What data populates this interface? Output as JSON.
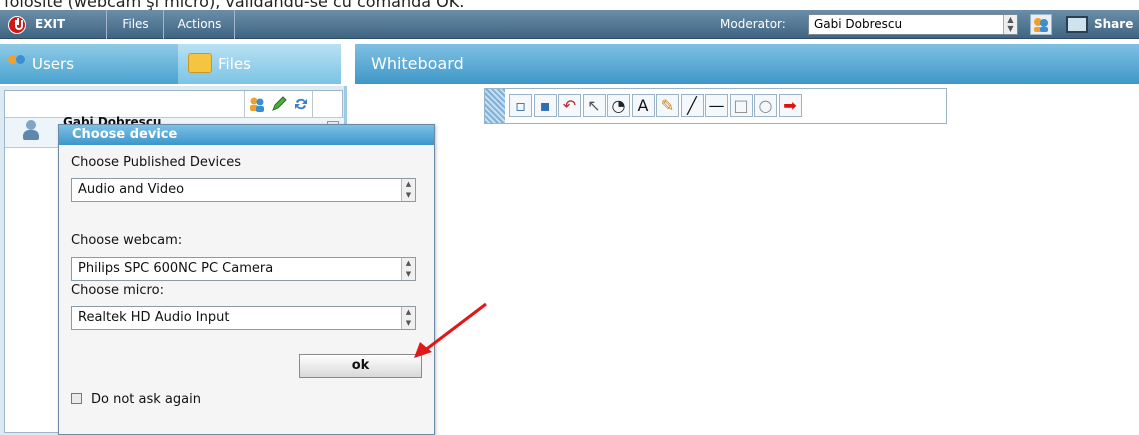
{
  "caption": "folosite (webcam şi micro), validându-se cu comanda OK.",
  "topbar": {
    "exit_label": "EXIT",
    "menu_files": "Files",
    "menu_actions": "Actions",
    "moderator_label": "Moderator:",
    "moderator_value": "Gabi Dobrescu",
    "share_label": "Share"
  },
  "tabs": {
    "users": "Users",
    "files": "Files",
    "whiteboard": "Whiteboard"
  },
  "user_list": {
    "users": [
      "Gabi Dobrescu"
    ]
  },
  "dialog": {
    "title": "Choose device",
    "published_label": "Choose Published Devices",
    "published_value": "Audio and Video",
    "webcam_label": "Choose webcam:",
    "webcam_value": "Philips SPC 600NC PC Camera",
    "micro_label": "Choose micro:",
    "micro_value": "Realtek HD Audio Input",
    "ok_label": "ok",
    "dont_ask_label": "Do not ask again"
  },
  "whiteboard_tools": [
    {
      "icon": "new-page-icon",
      "glyph": "▫",
      "color": "#2f6fb0"
    },
    {
      "icon": "save-icon",
      "glyph": "▪",
      "color": "#2f6fb0"
    },
    {
      "icon": "undo-icon",
      "glyph": "↶",
      "color": "#b03030"
    },
    {
      "icon": "pointer-icon",
      "glyph": "↖",
      "color": "#555555"
    },
    {
      "icon": "ellipse-select-icon",
      "glyph": "◔",
      "color": "#222222"
    },
    {
      "icon": "text-icon",
      "glyph": "A",
      "color": "#111111"
    },
    {
      "icon": "pencil-icon",
      "glyph": "✎",
      "color": "#c8842a"
    },
    {
      "icon": "line-icon",
      "glyph": "╱",
      "color": "#111111"
    },
    {
      "icon": "horizontal-line-icon",
      "glyph": "—",
      "color": "#111111"
    },
    {
      "icon": "rectangle-icon",
      "glyph": "□",
      "color": "#888888"
    },
    {
      "icon": "circle-icon",
      "glyph": "○",
      "color": "#888888"
    },
    {
      "icon": "arrow-icon",
      "glyph": "➡",
      "color": "#e01010"
    }
  ],
  "colors": {
    "accent": "#3b96cb",
    "annotation_arrow": "#e01818"
  }
}
